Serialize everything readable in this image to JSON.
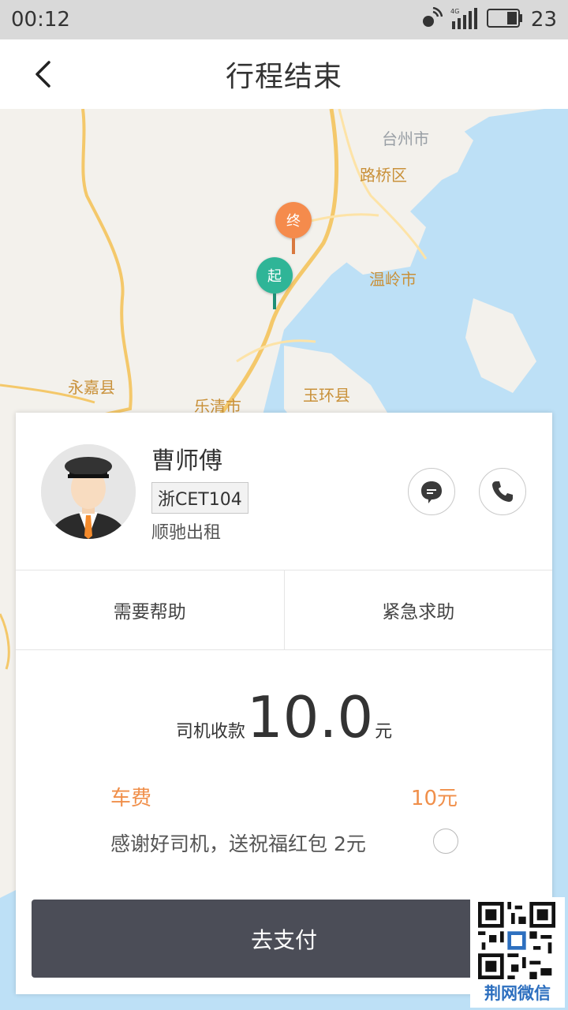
{
  "status_bar": {
    "time": "00:12",
    "battery": "23"
  },
  "nav": {
    "title": "行程结束"
  },
  "map": {
    "labels": [
      "台州市",
      "路桥区",
      "温岭市",
      "永嘉县",
      "乐清市",
      "玉环县"
    ],
    "end_marker": "终",
    "start_marker": "起"
  },
  "driver": {
    "name": "曹师傅",
    "plate": "浙CET104",
    "company": "顺驰出租"
  },
  "help": {
    "need_help": "需要帮助",
    "emergency": "紧急求助"
  },
  "fare": {
    "label": "司机收款",
    "amount": "10.0",
    "unit": "元"
  },
  "fee": {
    "label": "车费",
    "value": "10元"
  },
  "gift": {
    "text": "感谢好司机，送祝福红包  2元"
  },
  "pay": {
    "label": "去支付"
  },
  "watermark": {
    "text": "荆网微信"
  },
  "colors": {
    "accent": "#f08f4a",
    "pay_button": "#4b4d57",
    "start_pin": "#2fb597",
    "end_pin": "#f58b4c",
    "water": "#bde0f6"
  }
}
